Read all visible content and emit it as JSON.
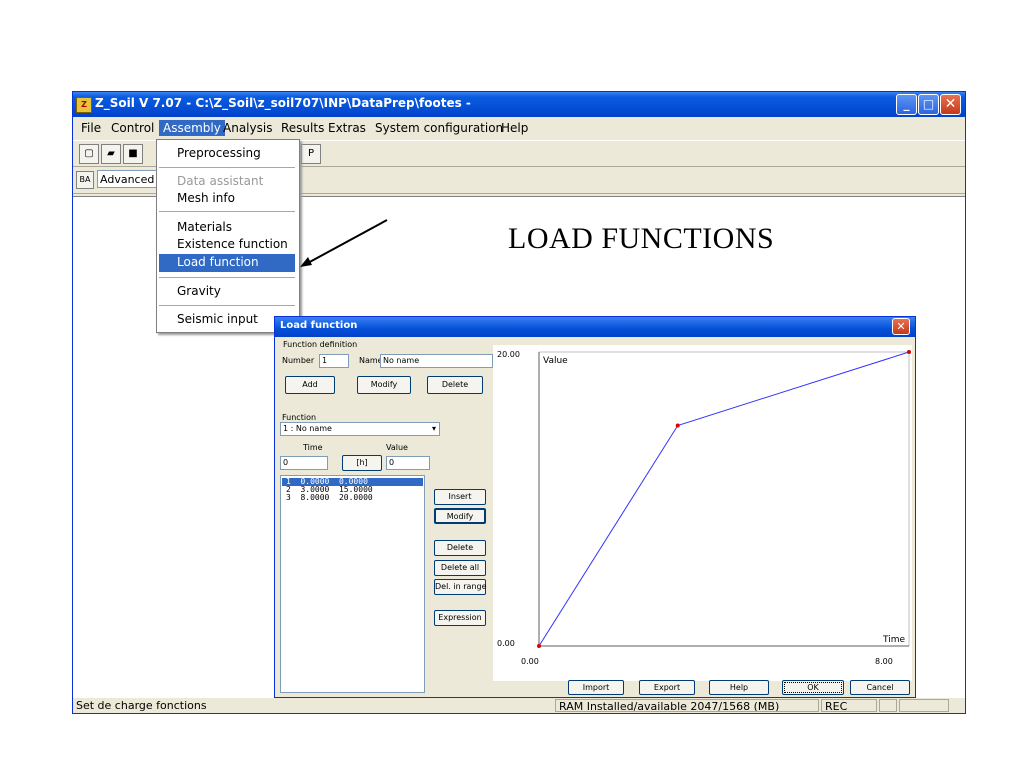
{
  "window": {
    "title": "Z_Soil V 7.07 - C:\\Z_Soil\\z_soil707\\INP\\DataPrep\\footes -",
    "icon_label": "Z"
  },
  "menu": [
    "File",
    "Control",
    "Assembly",
    "Analysis",
    "Results",
    "Extras",
    "System configuration",
    "Help"
  ],
  "toolbar": {
    "mode_combo": "Advanced"
  },
  "dropdown": {
    "items": [
      {
        "label": "Preprocessing",
        "disabled": false
      },
      {
        "label": "Data assistant",
        "disabled": true
      },
      {
        "label": "Mesh info",
        "disabled": false
      },
      {
        "label": "Materials",
        "disabled": false
      },
      {
        "label": "Existence function",
        "disabled": false
      },
      {
        "label": "Load function",
        "disabled": false,
        "selected": true
      },
      {
        "label": "Gravity",
        "disabled": false
      },
      {
        "label": "Seismic input",
        "disabled": false
      }
    ]
  },
  "slide_title": "LOAD FUNCTIONS",
  "statusbar": {
    "message": "Set de charge fonctions",
    "ram": "RAM Installed/available  2047/1568 (MB)",
    "rec": "REC"
  },
  "dialog": {
    "title": "Load function",
    "group_label": "Function definition",
    "number_label": "Number",
    "number_value": "1",
    "name_label": "Name",
    "name_value": "No name",
    "add": "Add",
    "modify": "Modify",
    "delete": "Delete",
    "function_label": "Function",
    "function_value": "1 : No name",
    "time_label": "Time",
    "value_label": "Value",
    "time_input": "0",
    "unit_button": "[h]",
    "value_input": "0",
    "list": [
      "1  0.0000  0.0000",
      "2  3.0000  15.0000",
      "3  8.0000  20.0000"
    ],
    "side_buttons": {
      "insert": "Insert",
      "modify": "Modify",
      "delete": "Delete",
      "delete_all": "Delete all",
      "del_range": "Del. in range",
      "expression": "Expression"
    },
    "bottom_buttons": {
      "import": "Import",
      "export": "Export",
      "help": "Help",
      "ok": "OK",
      "cancel": "Cancel"
    }
  },
  "chart_data": {
    "type": "line",
    "x": [
      0,
      3,
      8
    ],
    "y": [
      0,
      15,
      20
    ],
    "xlim": [
      0,
      8
    ],
    "ylim": [
      0,
      20
    ],
    "xlabel": "Time",
    "ylabel": "Value",
    "x_tick_labels": [
      "0.00",
      "8.00"
    ],
    "y_tick_labels": [
      "0.00",
      "20.00"
    ],
    "line_color": "#3333ff",
    "point_color": "#dd0000"
  }
}
